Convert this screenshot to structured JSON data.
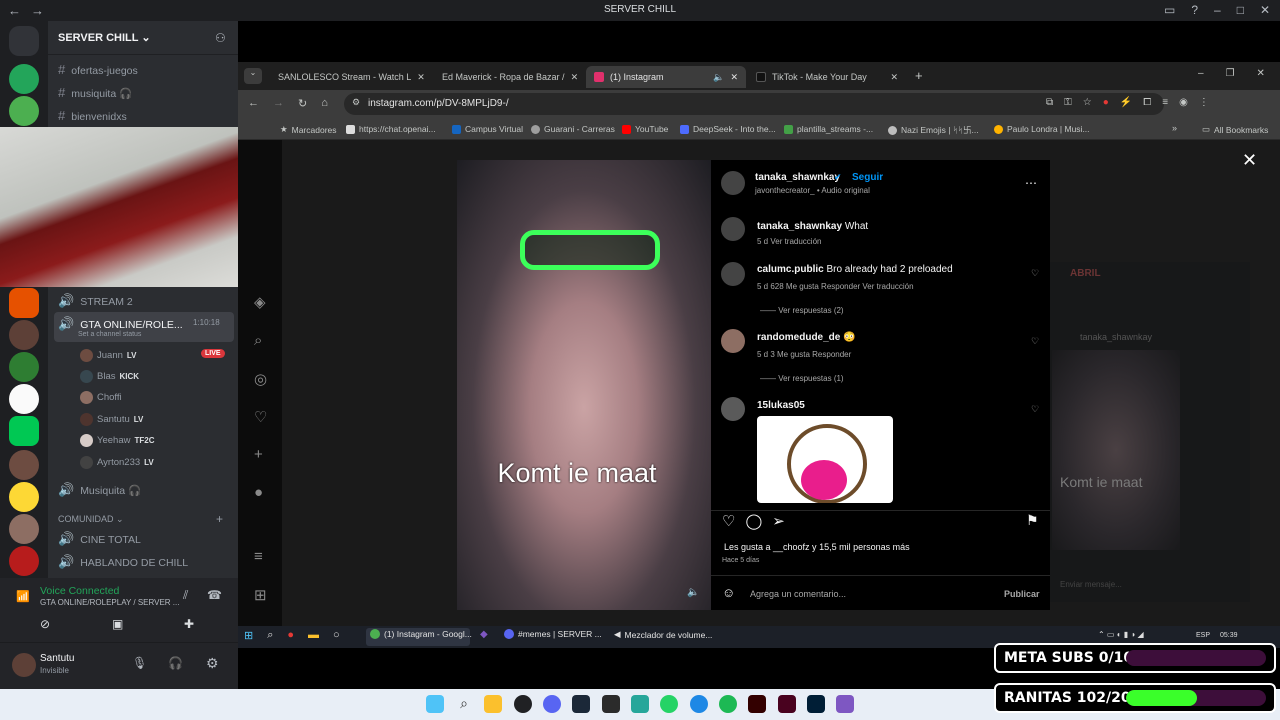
{
  "discord": {
    "title": "SERVER CHILL",
    "server_name": "SERVER CHILL",
    "channels": [
      "ofertas-juegos",
      "musiquita 🎧",
      "bienvenidxs"
    ],
    "stream2": "STREAM 2",
    "gta_channel": "GTA ONLINE/ROLE...",
    "gta_timer": "1:10:18",
    "gta_status": "Set a channel status",
    "voice_users": [
      {
        "name": "Juann",
        "tag": "LV"
      },
      {
        "name": "Blas",
        "tag": "KICK"
      },
      {
        "name": "Choffi",
        "tag": ""
      },
      {
        "name": "Santutu",
        "tag": "LV"
      },
      {
        "name": "Yeehaw",
        "tag": "TF2C"
      },
      {
        "name": "Ayrton233",
        "tag": "LV"
      }
    ],
    "live_badge": "LIVE",
    "musiquita": "Musiquita 🎧",
    "comunidad": "COMUNIDAD",
    "cine": "CINE TOTAL",
    "hablando": "HABLANDO DE CHILL",
    "voice_connected": "Voice Connected",
    "voice_channel": "GTA ONLINE/ROLEPLAY / SERVER ...",
    "user_name": "Santutu",
    "user_status": "Invisible"
  },
  "browser": {
    "tabs": [
      {
        "label": "SANLOLESCO Stream - Watch L",
        "color": "#53fc18"
      },
      {
        "label": "Ed Maverick - Ropa de Bazar /",
        "color": "#ff0000"
      },
      {
        "label": "(1) Instagram",
        "color": "#e1306c"
      },
      {
        "label": "TikTok - Make Your Day",
        "color": "#111111"
      }
    ],
    "url": "instagram.com/p/DV-8MPLjD9-/",
    "bookmarks": [
      "Marcadores",
      "https://chat.openai...",
      "Campus Virtual",
      "Guarani - Carreras",
      "YouTube",
      "DeepSeek - Into the...",
      "plantilla_streams -...",
      "Nazi Emojis | ᛋᛋ卐...",
      "Paulo Londra | Musi..."
    ],
    "all_bookmarks": "All Bookmarks"
  },
  "instagram": {
    "author": "tanaka_shawnkay",
    "follow": "Seguir",
    "audio": "javonthecreator_ • Audio original",
    "video_caption": "Komt ie maat",
    "comments": [
      {
        "user": "tanaka_shawnkay",
        "text": "What",
        "meta": "5 d   Ver traducción"
      },
      {
        "user": "calumc.public",
        "text": "Bro already had 2 preloaded",
        "meta": "5 d   628 Me gusta   Responder   Ver traducción",
        "replies": "Ver respuestas (2)"
      },
      {
        "user": "randomedude_de",
        "text": "😳",
        "meta": "5 d   3 Me gusta   Responder",
        "replies": "Ver respuestas (1)"
      },
      {
        "user": "15lukas05",
        "text": "",
        "meta": ""
      }
    ],
    "likes": "Les gusta a __choofz y 15,5 mil personas más",
    "time_ago": "Hace 5 días",
    "comment_placeholder": "Agrega un comentario...",
    "publish": "Publicar",
    "ghost_title": "ABRIL",
    "ghost_user": "tanaka_shawnkay",
    "ghost_caption": "Komt ie maat",
    "ghost_input": "Enviar mensaje..."
  },
  "taskbar": {
    "items": [
      "(1) Instagram - Googl...",
      "#memes | SERVER ...",
      "Mezclador de volume..."
    ],
    "lang": "ESP",
    "time": "05:39"
  },
  "overlay": {
    "meta_subs": "META SUBS 0/10",
    "meta_subs_progress": 0.0,
    "ranitas": "RANITAS 102/200",
    "ranitas_progress": 0.51,
    "meta_color": "#d14bd6",
    "ranitas_color": "#3aff2a"
  }
}
